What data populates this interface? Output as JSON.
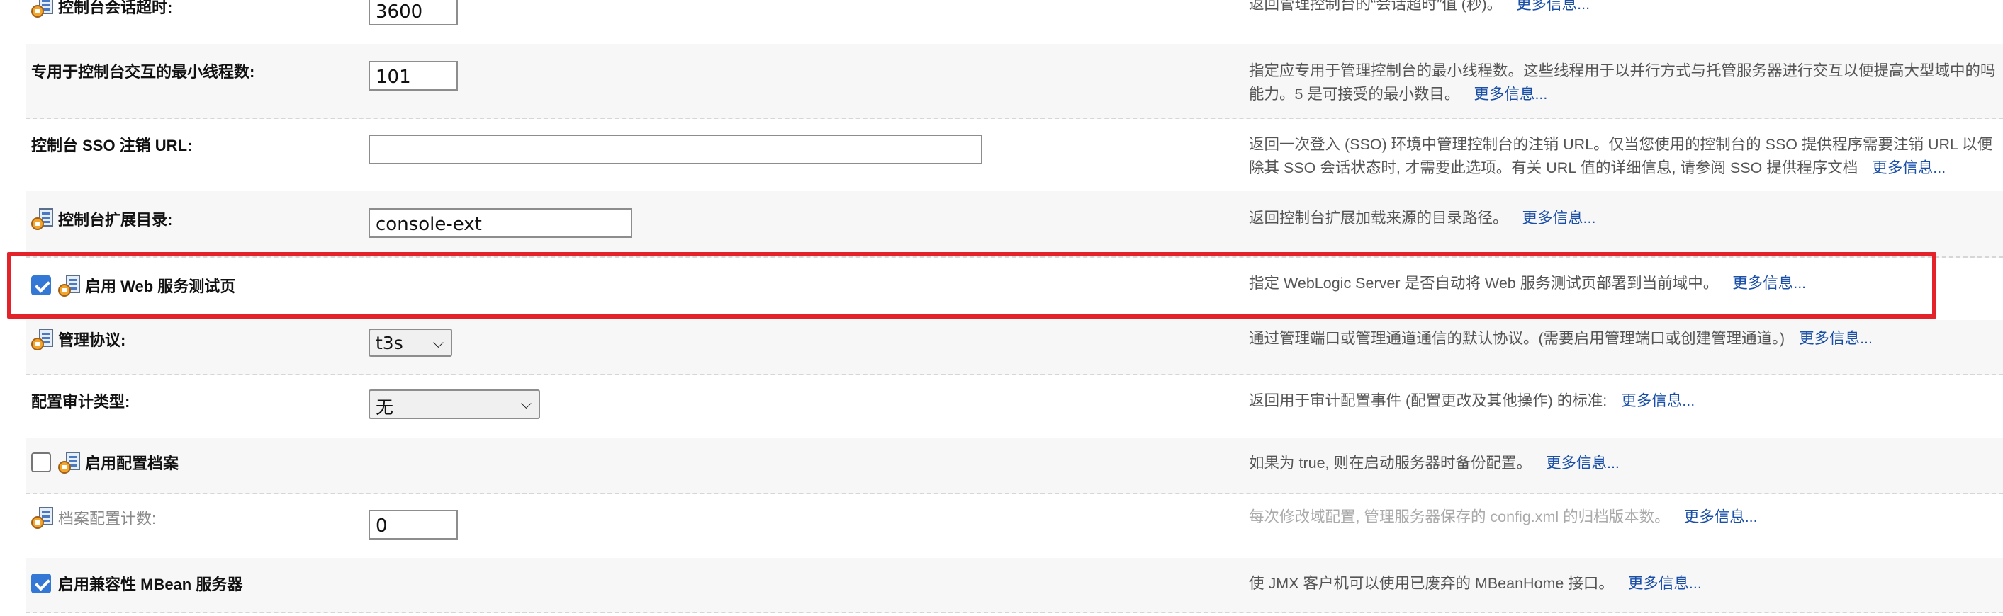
{
  "rows": [
    {
      "label": "控制台会话超时:",
      "value": "3600",
      "desc": "返回管理控制台的“会话超时”值 (秒)。",
      "more": "更多信息..."
    },
    {
      "label": "专用于控制台交互的最小线程数:",
      "value": "101",
      "desc1": "指定应专用于管理控制台的最小线程数。这些线程用于以并行方式与托管服务器进行交互以便提高大型域中的吗",
      "desc2": "能力。5 是可接受的最小数目。",
      "more": "更多信息..."
    },
    {
      "label": "控制台 SSO 注销 URL:",
      "value": "",
      "desc1": "返回一次登入 (SSO) 环境中管理控制台的注销 URL。仅当您使用的控制台的 SSO 提供程序需要注销 URL 以便",
      "desc2": "除其 SSO 会话状态时, 才需要此选项。有关 URL 值的详细信息, 请参阅 SSO 提供程序文档",
      "more": "更多信息..."
    },
    {
      "label": "控制台扩展目录:",
      "value": "console-ext",
      "desc": "返回控制台扩展加载来源的目录路径。",
      "more": "更多信息..."
    },
    {
      "label": "启用 Web 服务测试页",
      "checked": true,
      "desc": "指定 WebLogic Server 是否自动将 Web 服务测试页部署到当前域中。",
      "more": "更多信息..."
    },
    {
      "label": "管理协议:",
      "selected": "t3s",
      "desc": "通过管理端口或管理通道通信的默认协议。(需要启用管理端口或创建管理通道。)",
      "more": "更多信息..."
    },
    {
      "label": "配置审计类型:",
      "selected": "无",
      "desc": "返回用于审计配置事件 (配置更改及其他操作) 的标准:",
      "more": "更多信息..."
    },
    {
      "label": "启用配置档案",
      "checked": false,
      "desc": "如果为 true, 则在启动服务器时备份配置。",
      "more": "更多信息..."
    },
    {
      "label": "档案配置计数:",
      "value": "0",
      "desc": "每次修改域配置, 管理服务器保存的 config.xml 的归档版本数。",
      "more": "更多信息..."
    },
    {
      "label": "启用兼容性 MBean 服务器",
      "checked": true,
      "desc": "使 JMX 客户机可以使用已废弃的 MBeanHome 接口。",
      "more": "更多信息..."
    }
  ],
  "icon_name": "config-lock-icon",
  "colors": {
    "highlight": "#e4222a",
    "link": "#1a4fa8",
    "checkbox": "#3478d6"
  }
}
